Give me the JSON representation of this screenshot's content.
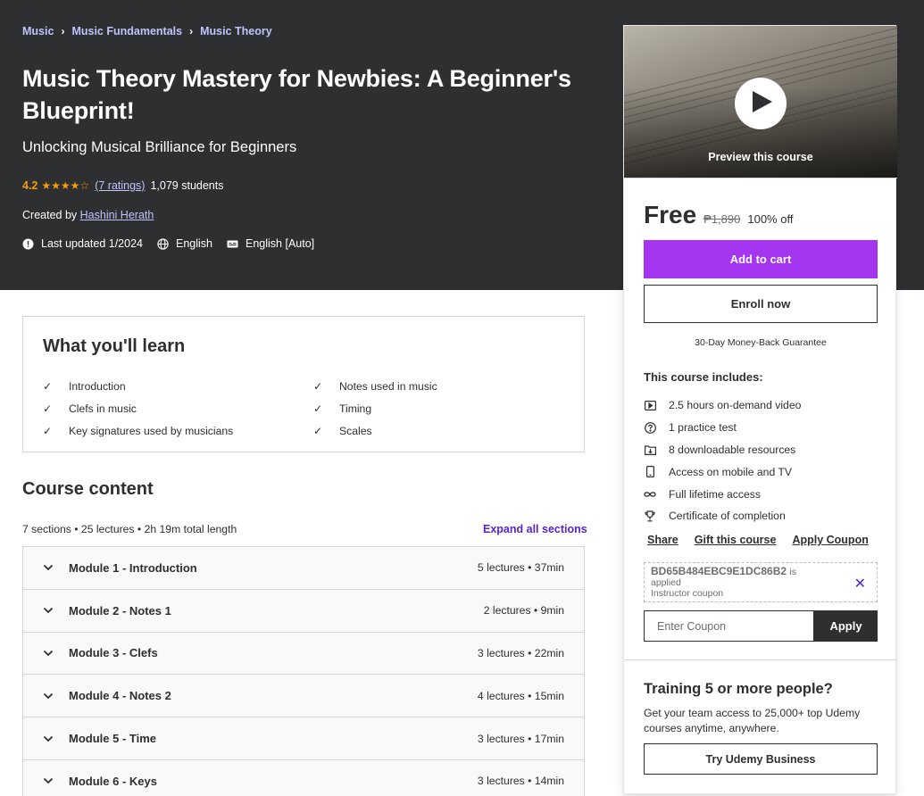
{
  "breadcrumbs": [
    "Music",
    "Music Fundamentals",
    "Music Theory"
  ],
  "course": {
    "title": "Music Theory Mastery for Newbies: A Beginner's Blueprint!",
    "subtitle": "Unlocking Musical Brilliance for Beginners",
    "rating": "4.2",
    "stars": "★★★★☆",
    "ratings_count": "(7 ratings)",
    "students": "1,079 students",
    "created_by_label": "Created by",
    "instructor": "Hashini Herath",
    "last_updated": "Last updated 1/2024",
    "language": "English",
    "captions": "English [Auto]"
  },
  "sidebar": {
    "preview_label": "Preview this course",
    "price": "Free",
    "original_price": "₱1,890",
    "discount": "100% off",
    "add_to_cart": "Add to cart",
    "enroll_now": "Enroll now",
    "guarantee": "30-Day Money-Back Guarantee",
    "includes_title": "This course includes:",
    "includes": [
      {
        "icon": "video-icon",
        "text": "2.5 hours on-demand video"
      },
      {
        "icon": "question-icon",
        "text": "1 practice test"
      },
      {
        "icon": "download-icon",
        "text": "8 downloadable resources"
      },
      {
        "icon": "mobile-icon",
        "text": "Access on mobile and TV"
      },
      {
        "icon": "infinity-icon",
        "text": "Full lifetime access"
      },
      {
        "icon": "trophy-icon",
        "text": "Certificate of completion"
      }
    ],
    "share": "Share",
    "gift": "Gift this course",
    "apply_coupon": "Apply Coupon",
    "coupon_code": "BD65B484EBC9E1DC86B2",
    "coupon_is": "is",
    "coupon_applied": "applied",
    "coupon_type": "Instructor coupon",
    "coupon_placeholder": "Enter Coupon",
    "apply": "Apply",
    "business_title": "Training 5 or more people?",
    "business_desc": "Get your team access to 25,000+ top Udemy courses anytime, anywhere.",
    "business_button": "Try Udemy Business"
  },
  "learn": {
    "title": "What you'll learn",
    "items": [
      "Introduction",
      "Notes used in music",
      "Clefs in music",
      "Timing",
      "Key signatures used by musicians",
      "Scales"
    ]
  },
  "content": {
    "title": "Course content",
    "meta": "7 sections • 25 lectures • 2h 19m total length",
    "expand": "Expand all sections",
    "sections": [
      {
        "name": "Module 1 - Introduction",
        "info": "5 lectures • 37min"
      },
      {
        "name": "Module 2 - Notes 1",
        "info": "2 lectures • 9min"
      },
      {
        "name": "Module 3 - Clefs",
        "info": "3 lectures • 22min"
      },
      {
        "name": "Module 4 - Notes 2",
        "info": "4 lectures • 15min"
      },
      {
        "name": "Module 5 - Time",
        "info": "3 lectures • 17min"
      },
      {
        "name": "Module 6 - Keys",
        "info": "3 lectures • 14min"
      }
    ]
  },
  "colors": {
    "header_bg": "#2d2f31",
    "accent": "#a435f0",
    "link": "#c0c4fc",
    "star": "#f69c08",
    "purple_link": "#5624d0"
  }
}
